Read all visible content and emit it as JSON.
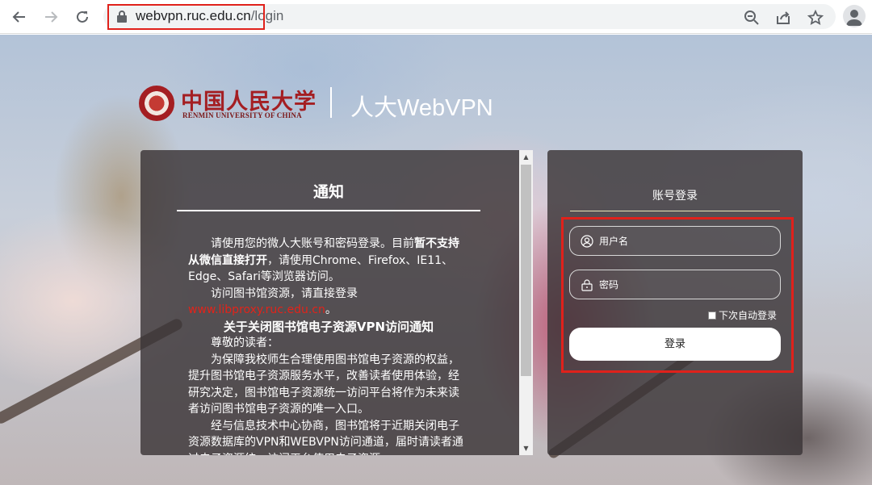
{
  "browser": {
    "url_host": "webvpn.ruc.edu.cn",
    "url_path": "/login"
  },
  "header": {
    "logo_cn": "中国人民大学",
    "logo_en": "RENMIN UNIVERSITY OF CHINA",
    "site_title": "人大WebVPN"
  },
  "notice": {
    "title": "通知",
    "p1_a": "请使用您的微人大账号和密码登录。目前",
    "p1_b": "暂不支持从微信直接打开",
    "p1_c": "，请使用Chrome、Firefox、IE11、Edge、Safari等浏览器访问。",
    "p2_a": "访问图书馆资源，请直接登录",
    "p2_link": "www.libproxy.ruc.edu.cn",
    "p2_end": "。",
    "subhead": "关于关闭图书馆电子资源VPN访问通知",
    "greeting": "尊敬的读者：",
    "p3": "为保障我校师生合理使用图书馆电子资源的权益，提升图书馆电子资源服务水平，改善读者使用体验，经研究决定，图书馆电子资源统一访问平台将作为未来读者访问图书馆电子资源的唯一入口。",
    "p4": "经与信息技术中心协商，图书馆将于近期关闭电子资源数据库的VPN和WEBVPN访问通道，届时请读者通过电子资源统一访问平台使用电子资源。"
  },
  "login": {
    "title": "账号登录",
    "username_placeholder": "用户名",
    "password_placeholder": "密码",
    "remember_label": "下次自动登录",
    "submit_label": "登录"
  },
  "colors": {
    "highlight": "#e0211b",
    "brand_red": "#a41e22",
    "panel_bg": "rgba(58,52,55,0.82)"
  }
}
